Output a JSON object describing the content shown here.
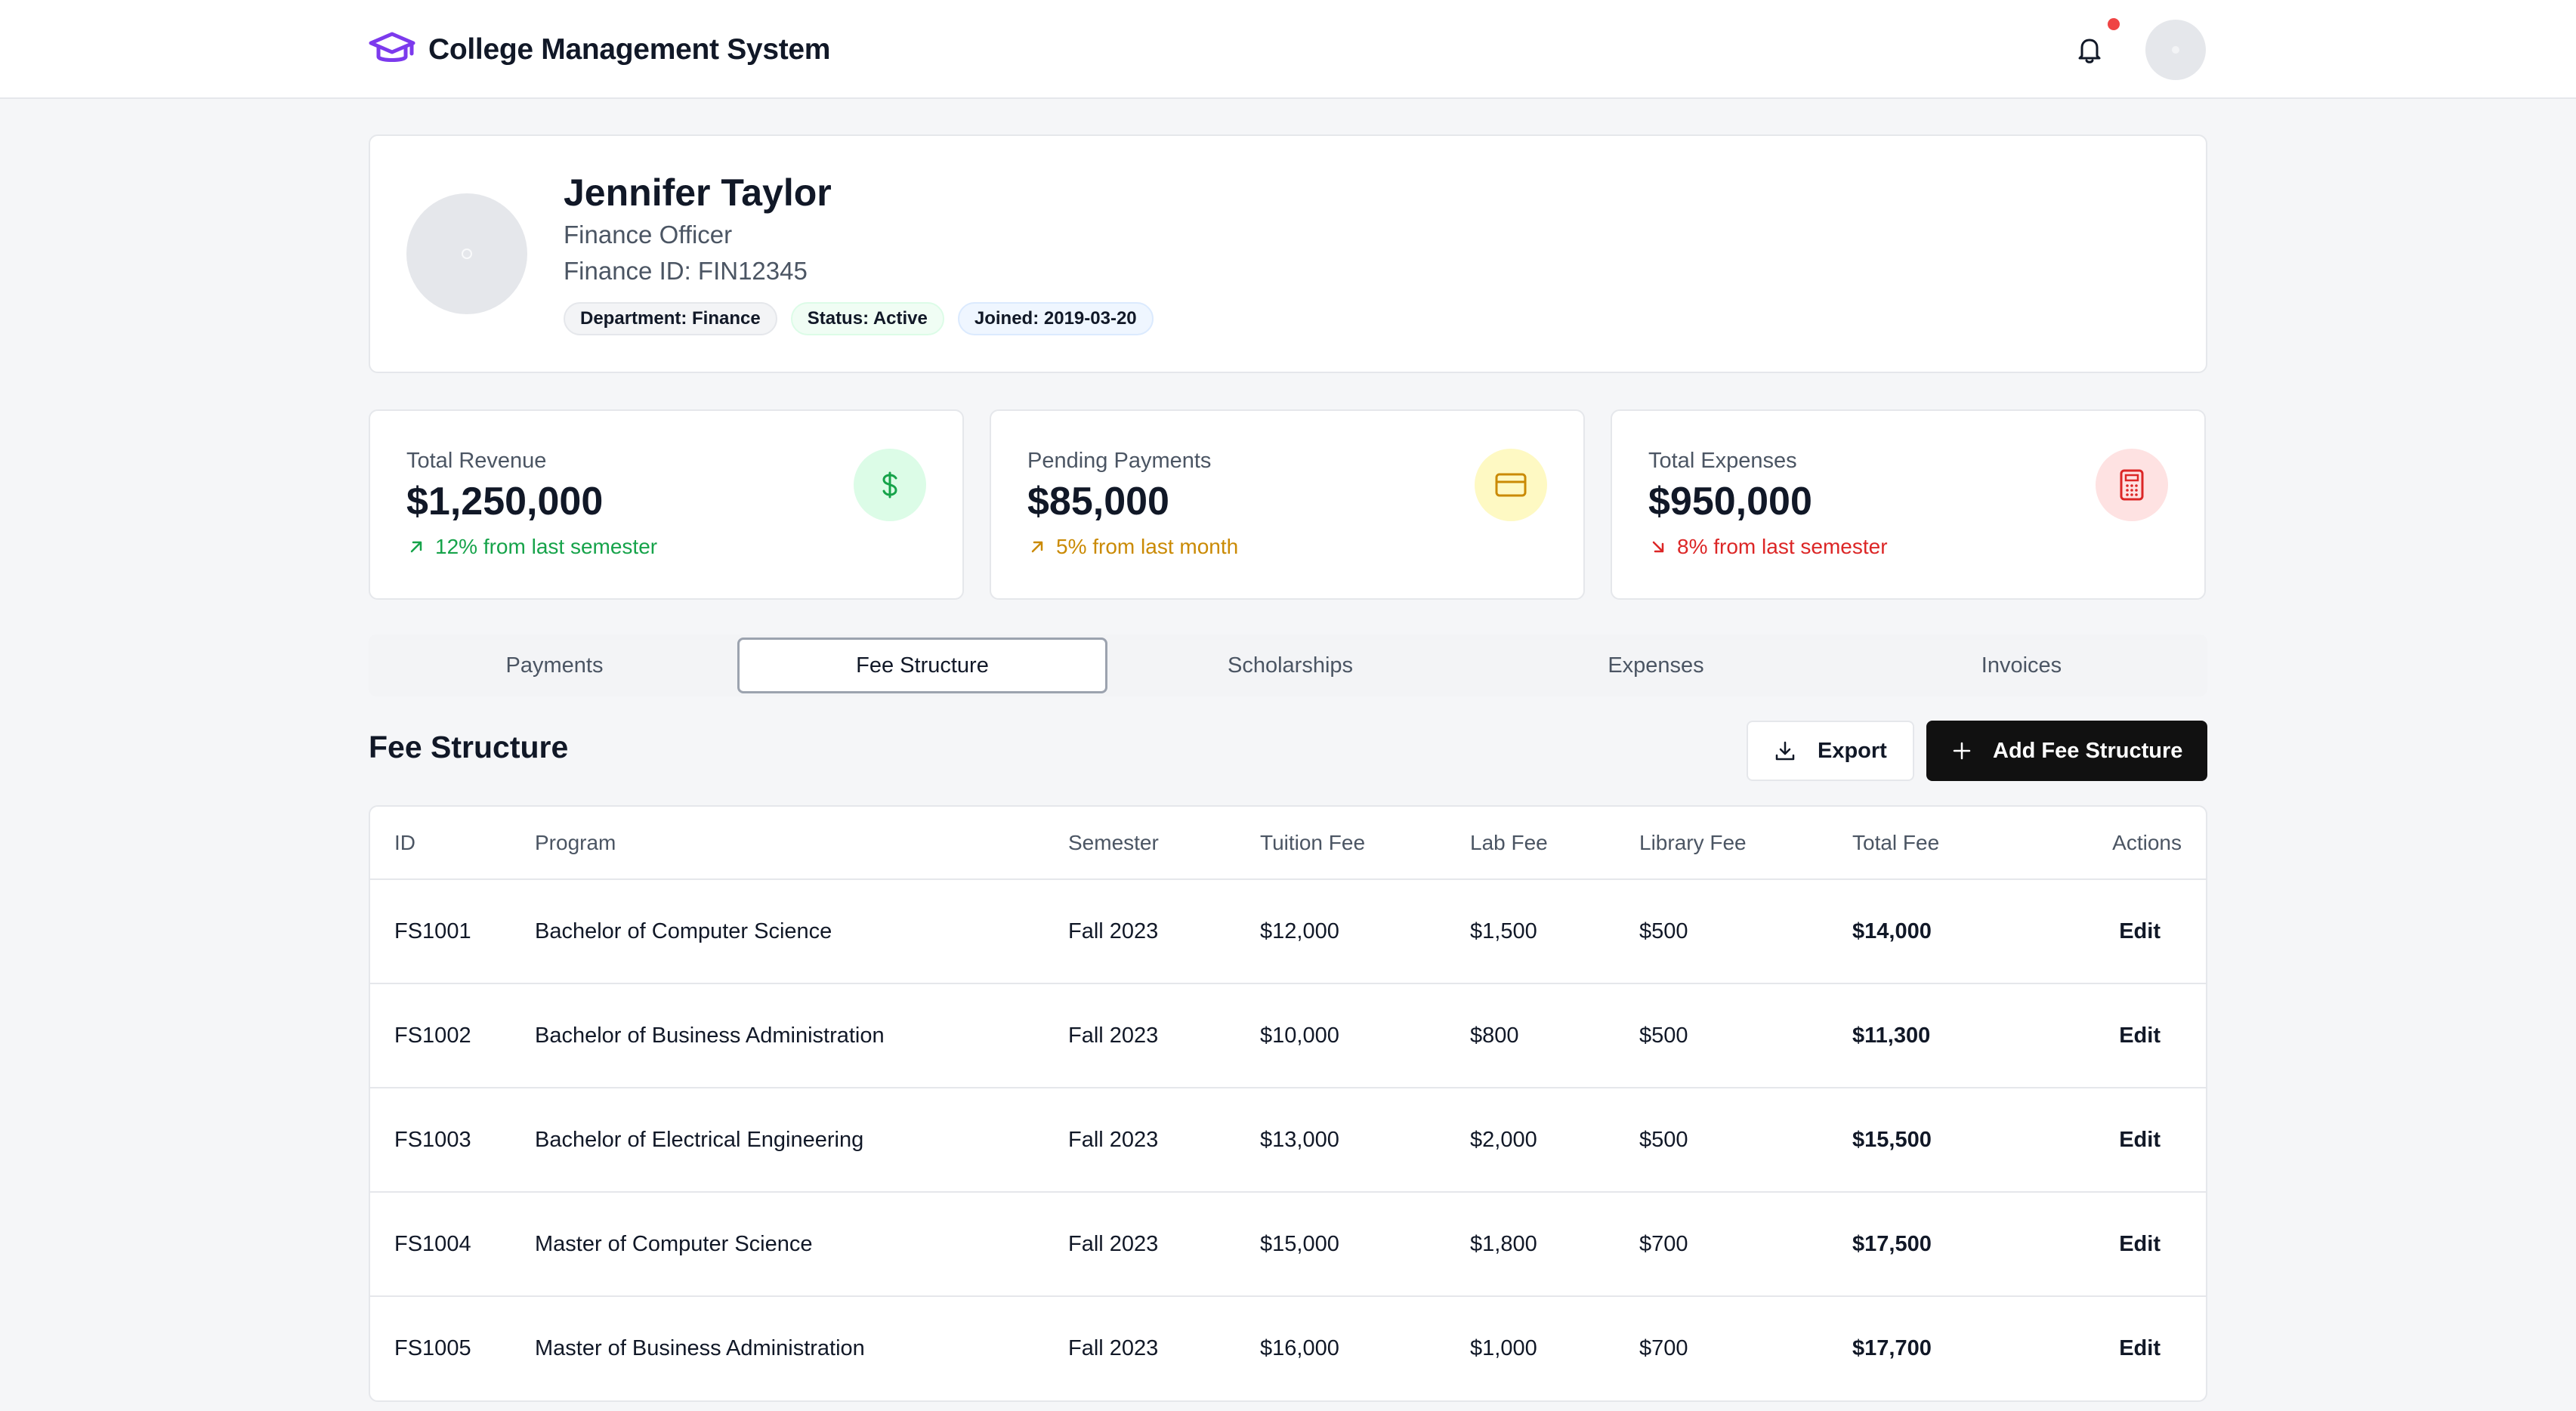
{
  "app": {
    "title": "College Management System"
  },
  "profile": {
    "name": "Jennifer Taylor",
    "role": "Finance Officer",
    "finance_id": "Finance ID: FIN12345",
    "badges": {
      "department": "Department: Finance",
      "status": "Status: Active",
      "joined": "Joined: 2019-03-20"
    }
  },
  "stats": [
    {
      "label": "Total Revenue",
      "value": "$1,250,000",
      "trend": "12% from last semester",
      "direction": "up",
      "icon": "dollar-icon",
      "color": "#16a34a"
    },
    {
      "label": "Pending Payments",
      "value": "$85,000",
      "trend": "5% from last month",
      "direction": "up",
      "icon": "credit-card-icon",
      "color": "#ca8a04"
    },
    {
      "label": "Total Expenses",
      "value": "$950,000",
      "trend": "8% from last semester",
      "direction": "down",
      "icon": "calculator-icon",
      "color": "#dc2626"
    }
  ],
  "tabs": [
    "Payments",
    "Fee Structure",
    "Scholarships",
    "Expenses",
    "Invoices"
  ],
  "active_tab": "Fee Structure",
  "section": {
    "title": "Fee Structure",
    "export_label": "Export",
    "add_label": "Add Fee Structure"
  },
  "table": {
    "headers": [
      "ID",
      "Program",
      "Semester",
      "Tuition Fee",
      "Lab Fee",
      "Library Fee",
      "Total Fee",
      "Actions"
    ],
    "rows": [
      [
        "FS1001",
        "Bachelor of Computer Science",
        "Fall 2023",
        "$12,000",
        "$1,500",
        "$500",
        "$14,000",
        "Edit"
      ],
      [
        "FS1002",
        "Bachelor of Business Administration",
        "Fall 2023",
        "$10,000",
        "$800",
        "$500",
        "$11,300",
        "Edit"
      ],
      [
        "FS1003",
        "Bachelor of Electrical Engineering",
        "Fall 2023",
        "$13,000",
        "$2,000",
        "$500",
        "$15,500",
        "Edit"
      ],
      [
        "FS1004",
        "Master of Computer Science",
        "Fall 2023",
        "$15,000",
        "$1,800",
        "$700",
        "$17,500",
        "Edit"
      ],
      [
        "FS1005",
        "Master of Business Administration",
        "Fall 2023",
        "$16,000",
        "$1,000",
        "$700",
        "$17,700",
        "Edit"
      ]
    ]
  },
  "colors": {
    "brand": "#7c3aed",
    "primary_button": "#111111",
    "notification": "#ef4444"
  }
}
